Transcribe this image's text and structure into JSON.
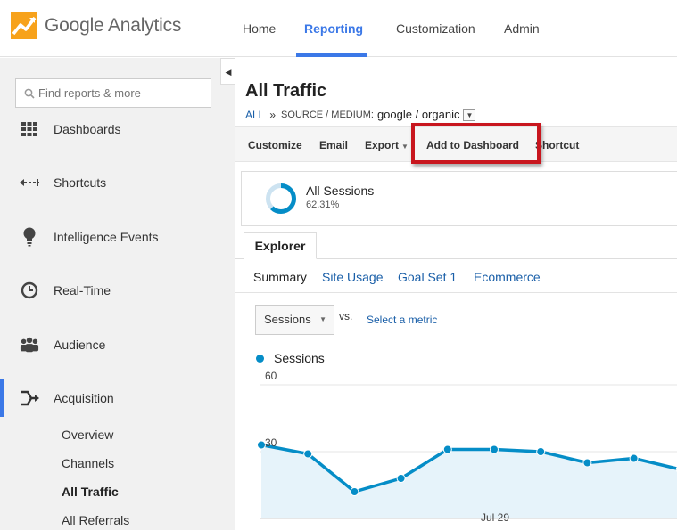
{
  "app": {
    "logo_text": "Google Analytics"
  },
  "nav": {
    "home": "Home",
    "reporting": "Reporting",
    "customization": "Customization",
    "admin": "Admin"
  },
  "sidebar": {
    "search_placeholder": "Find reports & more",
    "items": [
      {
        "label": "Dashboards",
        "icon": "grid-icon"
      },
      {
        "label": "Shortcuts",
        "icon": "shortcut-arrow-icon"
      },
      {
        "label": "Intelligence Events",
        "icon": "lightbulb-icon"
      },
      {
        "label": "Real-Time",
        "icon": "clock-icon"
      },
      {
        "label": "Audience",
        "icon": "people-icon"
      },
      {
        "label": "Acquisition",
        "icon": "acquisition-arrows-icon"
      }
    ],
    "sub_items": [
      "Overview",
      "Channels",
      "All Traffic",
      "All Referrals"
    ],
    "active_sub": "All Traffic"
  },
  "main": {
    "title": "All Traffic",
    "breadcrumb": {
      "root": "ALL",
      "separator": "»",
      "dimension": "SOURCE / MEDIUM:",
      "value": "google / organic"
    },
    "actions": {
      "customize": "Customize",
      "email": "Email",
      "export": "Export",
      "add_to_dashboard": "Add to Dashboard",
      "shortcut": "Shortcut"
    },
    "segment": {
      "name": "All Sessions",
      "percent": "62.31%",
      "fraction": 0.6231
    },
    "tab": "Explorer",
    "subtabs": [
      "Summary",
      "Site Usage",
      "Goal Set 1",
      "Ecommerce"
    ],
    "metric_select": "Sessions",
    "vs": "vs.",
    "select_metric": "Select a metric",
    "legend": "Sessions"
  },
  "colors": {
    "accent": "#3b78e7",
    "series": "#058dc7",
    "area": "#e6f3fa",
    "highlight": "#c8161e"
  },
  "chart_data": {
    "type": "area",
    "series": [
      {
        "name": "Sessions",
        "values": [
          33,
          29,
          12,
          18,
          31,
          31,
          30,
          25,
          27,
          22
        ]
      }
    ],
    "y_ticks": [
      30,
      60
    ],
    "ylim": [
      0,
      60
    ],
    "x_tick_label": "Jul 29",
    "grid": true
  }
}
